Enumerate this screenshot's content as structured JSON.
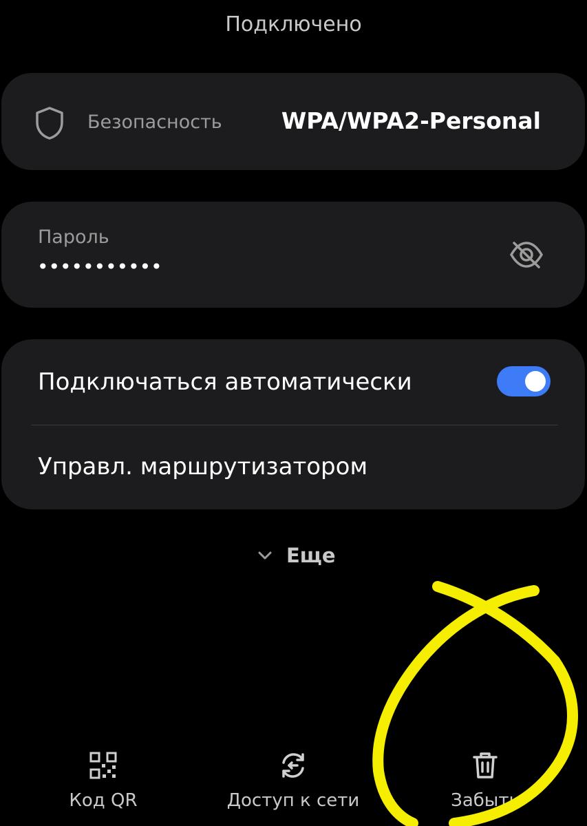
{
  "status": "Подключено",
  "security": {
    "label": "Безопасность",
    "value": "WPA/WPA2-Personal"
  },
  "password": {
    "label": "Пароль",
    "masked_value": "•••••••••••"
  },
  "auto_connect": {
    "label": "Подключаться автоматически",
    "enabled": true
  },
  "router": {
    "label": "Управл. маршрутизатором"
  },
  "more": {
    "label": "Еще"
  },
  "bottom_actions": [
    {
      "label": "Код QR",
      "icon": "qr-code-icon"
    },
    {
      "label": "Доступ к сети",
      "icon": "share-network-icon"
    },
    {
      "label": "Забыть",
      "icon": "trash-icon"
    }
  ],
  "colors": {
    "background": "#000000",
    "card": "#1c1c1e",
    "toggle_on": "#3e7bf7",
    "annotation": "#f5ee00"
  }
}
